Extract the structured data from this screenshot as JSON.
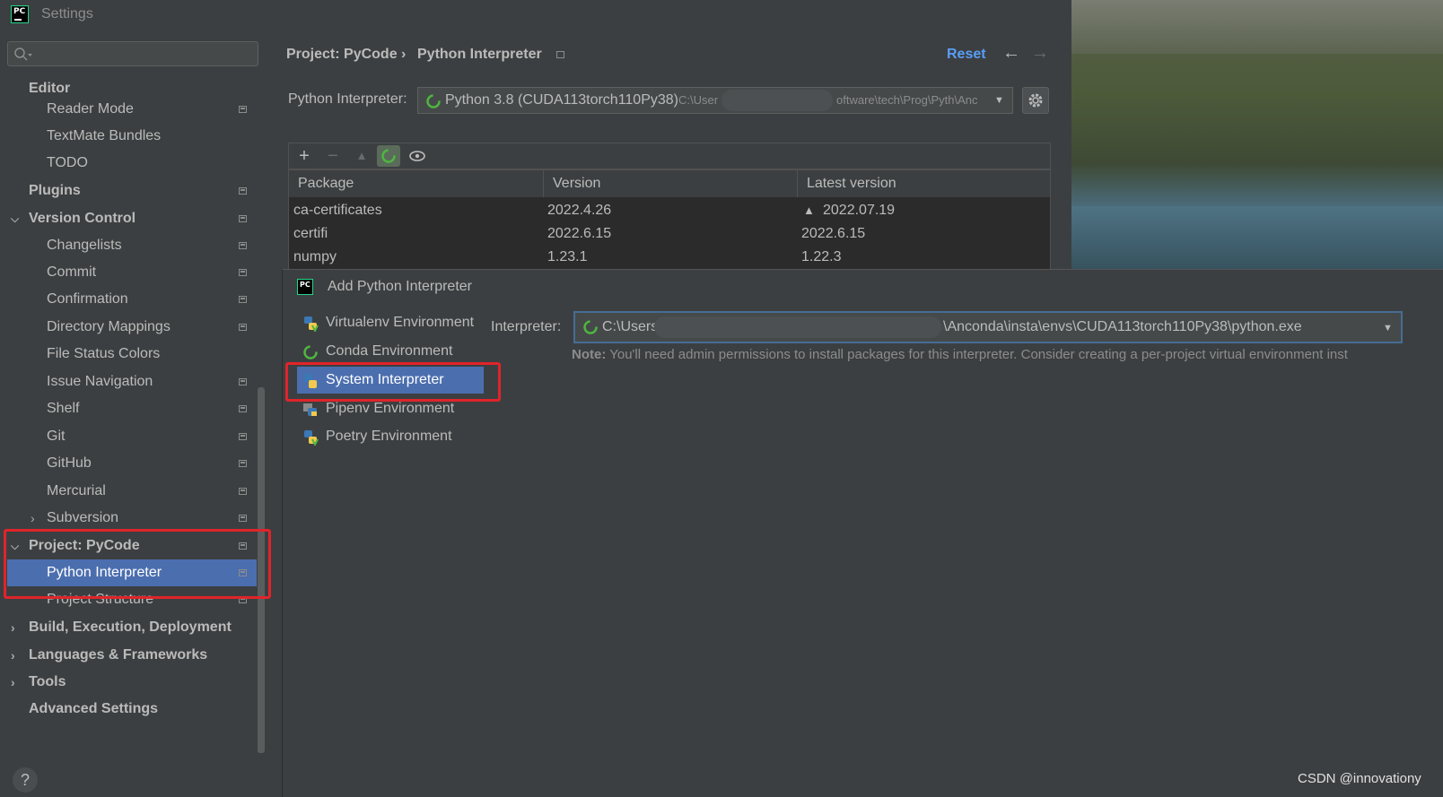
{
  "window": {
    "title": "Settings"
  },
  "sidebar": {
    "search_placeholder": "",
    "items": [
      {
        "label": "Editor",
        "bold": true
      },
      {
        "label": "Reader Mode"
      },
      {
        "label": "TextMate Bundles"
      },
      {
        "label": "TODO"
      },
      {
        "label": "Plugins",
        "bold": true
      },
      {
        "label": "Version Control",
        "bold": true
      },
      {
        "label": "Changelists"
      },
      {
        "label": "Commit"
      },
      {
        "label": "Confirmation"
      },
      {
        "label": "Directory Mappings"
      },
      {
        "label": "File Status Colors"
      },
      {
        "label": "Issue Navigation"
      },
      {
        "label": "Shelf"
      },
      {
        "label": "Git"
      },
      {
        "label": "GitHub"
      },
      {
        "label": "Mercurial"
      },
      {
        "label": "Subversion"
      },
      {
        "label": "Project: PyCode",
        "bold": true
      },
      {
        "label": "Python Interpreter",
        "selected": true
      },
      {
        "label": "Project Structure"
      },
      {
        "label": "Build, Execution, Deployment",
        "bold": true
      },
      {
        "label": "Languages & Frameworks",
        "bold": true
      },
      {
        "label": "Tools",
        "bold": true
      },
      {
        "label": "Advanced Settings",
        "bold": true
      }
    ],
    "help": "?"
  },
  "content": {
    "breadcrumb_project": "Project: PyCode",
    "breadcrumb_sep": "›",
    "breadcrumb_page": "Python Interpreter",
    "reset_label": "Reset",
    "interpreter_label": "Python Interpreter:",
    "interpreter_name": "Python 3.8 (CUDA113torch110Py38)",
    "interpreter_path_start": "C:\\User",
    "interpreter_path_end": "oftware\\tech\\Prog\\Pyth\\Anc",
    "table": {
      "headers": [
        "Package",
        "Version",
        "Latest version"
      ],
      "rows": [
        {
          "package": "ca-certificates",
          "version": "2022.4.26",
          "latest": "2022.07.19",
          "upgrade": true
        },
        {
          "package": "certifi",
          "version": "2022.6.15",
          "latest": "2022.6.15"
        },
        {
          "package": "numpy",
          "version": "1.23.1",
          "latest": "1.22.3"
        }
      ]
    }
  },
  "dialog": {
    "title": "Add Python Interpreter",
    "env_types": [
      {
        "label": "Virtualenv Environment",
        "icon": "python-venv-icon"
      },
      {
        "label": "Conda Environment",
        "icon": "conda-icon"
      },
      {
        "label": "System Interpreter",
        "icon": "python-icon",
        "selected": true
      },
      {
        "label": "Pipenv Environment",
        "icon": "pipenv-icon"
      },
      {
        "label": "Poetry Environment",
        "icon": "poetry-icon"
      }
    ],
    "interpreter_label": "Interpreter:",
    "interpreter_path_start": "C:\\Users",
    "interpreter_path_end": "\\Anconda\\insta\\envs\\CUDA113torch110Py38\\python.exe",
    "note_bold": "Note:",
    "note_text": " You'll need admin permissions to install packages for this interpreter. Consider creating a per-project virtual environment inst"
  },
  "watermark": "CSDN @innovationy",
  "colors": {
    "selection": "#4b6eaf",
    "highlight_box": "#e0242a",
    "link": "#589df6"
  }
}
